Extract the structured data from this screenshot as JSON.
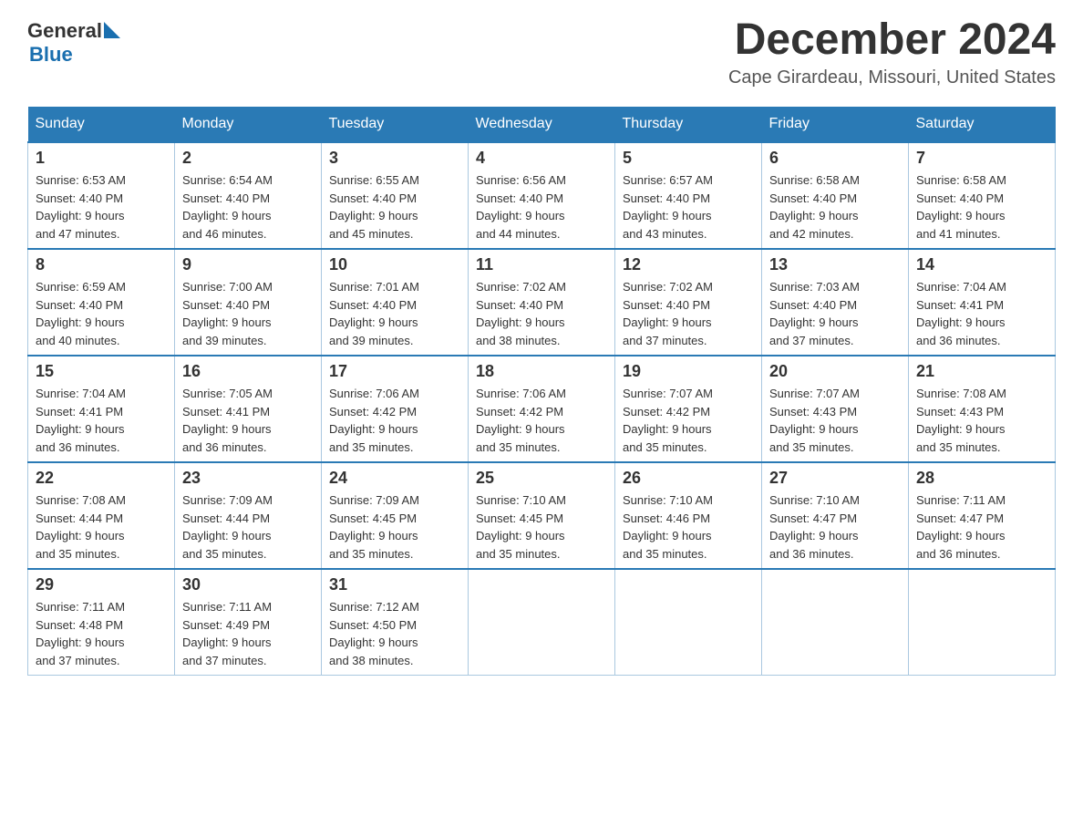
{
  "header": {
    "logo_general": "General",
    "logo_blue": "Blue",
    "month_year": "December 2024",
    "location": "Cape Girardeau, Missouri, United States"
  },
  "weekdays": [
    "Sunday",
    "Monday",
    "Tuesday",
    "Wednesday",
    "Thursday",
    "Friday",
    "Saturday"
  ],
  "weeks": [
    [
      {
        "day": "1",
        "sunrise": "6:53 AM",
        "sunset": "4:40 PM",
        "daylight": "9 hours and 47 minutes."
      },
      {
        "day": "2",
        "sunrise": "6:54 AM",
        "sunset": "4:40 PM",
        "daylight": "9 hours and 46 minutes."
      },
      {
        "day": "3",
        "sunrise": "6:55 AM",
        "sunset": "4:40 PM",
        "daylight": "9 hours and 45 minutes."
      },
      {
        "day": "4",
        "sunrise": "6:56 AM",
        "sunset": "4:40 PM",
        "daylight": "9 hours and 44 minutes."
      },
      {
        "day": "5",
        "sunrise": "6:57 AM",
        "sunset": "4:40 PM",
        "daylight": "9 hours and 43 minutes."
      },
      {
        "day": "6",
        "sunrise": "6:58 AM",
        "sunset": "4:40 PM",
        "daylight": "9 hours and 42 minutes."
      },
      {
        "day": "7",
        "sunrise": "6:58 AM",
        "sunset": "4:40 PM",
        "daylight": "9 hours and 41 minutes."
      }
    ],
    [
      {
        "day": "8",
        "sunrise": "6:59 AM",
        "sunset": "4:40 PM",
        "daylight": "9 hours and 40 minutes."
      },
      {
        "day": "9",
        "sunrise": "7:00 AM",
        "sunset": "4:40 PM",
        "daylight": "9 hours and 39 minutes."
      },
      {
        "day": "10",
        "sunrise": "7:01 AM",
        "sunset": "4:40 PM",
        "daylight": "9 hours and 39 minutes."
      },
      {
        "day": "11",
        "sunrise": "7:02 AM",
        "sunset": "4:40 PM",
        "daylight": "9 hours and 38 minutes."
      },
      {
        "day": "12",
        "sunrise": "7:02 AM",
        "sunset": "4:40 PM",
        "daylight": "9 hours and 37 minutes."
      },
      {
        "day": "13",
        "sunrise": "7:03 AM",
        "sunset": "4:40 PM",
        "daylight": "9 hours and 37 minutes."
      },
      {
        "day": "14",
        "sunrise": "7:04 AM",
        "sunset": "4:41 PM",
        "daylight": "9 hours and 36 minutes."
      }
    ],
    [
      {
        "day": "15",
        "sunrise": "7:04 AM",
        "sunset": "4:41 PM",
        "daylight": "9 hours and 36 minutes."
      },
      {
        "day": "16",
        "sunrise": "7:05 AM",
        "sunset": "4:41 PM",
        "daylight": "9 hours and 36 minutes."
      },
      {
        "day": "17",
        "sunrise": "7:06 AM",
        "sunset": "4:42 PM",
        "daylight": "9 hours and 35 minutes."
      },
      {
        "day": "18",
        "sunrise": "7:06 AM",
        "sunset": "4:42 PM",
        "daylight": "9 hours and 35 minutes."
      },
      {
        "day": "19",
        "sunrise": "7:07 AM",
        "sunset": "4:42 PM",
        "daylight": "9 hours and 35 minutes."
      },
      {
        "day": "20",
        "sunrise": "7:07 AM",
        "sunset": "4:43 PM",
        "daylight": "9 hours and 35 minutes."
      },
      {
        "day": "21",
        "sunrise": "7:08 AM",
        "sunset": "4:43 PM",
        "daylight": "9 hours and 35 minutes."
      }
    ],
    [
      {
        "day": "22",
        "sunrise": "7:08 AM",
        "sunset": "4:44 PM",
        "daylight": "9 hours and 35 minutes."
      },
      {
        "day": "23",
        "sunrise": "7:09 AM",
        "sunset": "4:44 PM",
        "daylight": "9 hours and 35 minutes."
      },
      {
        "day": "24",
        "sunrise": "7:09 AM",
        "sunset": "4:45 PM",
        "daylight": "9 hours and 35 minutes."
      },
      {
        "day": "25",
        "sunrise": "7:10 AM",
        "sunset": "4:45 PM",
        "daylight": "9 hours and 35 minutes."
      },
      {
        "day": "26",
        "sunrise": "7:10 AM",
        "sunset": "4:46 PM",
        "daylight": "9 hours and 35 minutes."
      },
      {
        "day": "27",
        "sunrise": "7:10 AM",
        "sunset": "4:47 PM",
        "daylight": "9 hours and 36 minutes."
      },
      {
        "day": "28",
        "sunrise": "7:11 AM",
        "sunset": "4:47 PM",
        "daylight": "9 hours and 36 minutes."
      }
    ],
    [
      {
        "day": "29",
        "sunrise": "7:11 AM",
        "sunset": "4:48 PM",
        "daylight": "9 hours and 37 minutes."
      },
      {
        "day": "30",
        "sunrise": "7:11 AM",
        "sunset": "4:49 PM",
        "daylight": "9 hours and 37 minutes."
      },
      {
        "day": "31",
        "sunrise": "7:12 AM",
        "sunset": "4:50 PM",
        "daylight": "9 hours and 38 minutes."
      },
      null,
      null,
      null,
      null
    ]
  ]
}
